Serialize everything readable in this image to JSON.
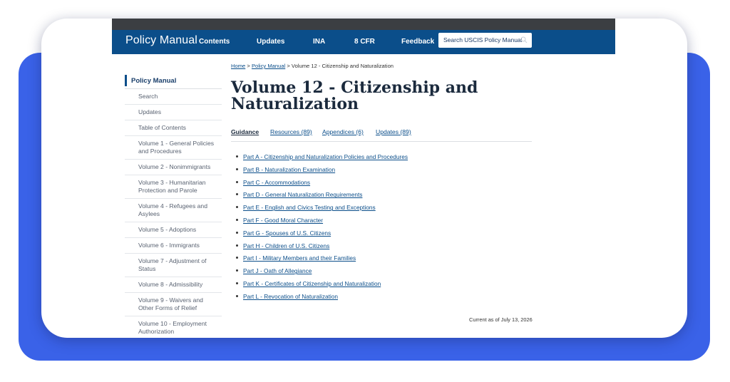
{
  "header": {
    "brand": "Policy Manual",
    "nav": [
      "Contents",
      "Updates",
      "INA",
      "8 CFR",
      "Feedback"
    ],
    "search_placeholder": "Search USCIS Policy Manual"
  },
  "breadcrumb": {
    "home": "Home",
    "sep": ">",
    "policy_manual": "Policy Manual",
    "current": "Volume 12 - Citizenship and Naturalization"
  },
  "page_title": "Volume 12 - Citizenship and Naturalization",
  "tabs": [
    "Guidance",
    "Resources (89)",
    "Appendices (6)",
    "Updates (89)"
  ],
  "parts": [
    "Part A - Citizenship and Naturalization Policies and Procedures",
    "Part B - Naturalization Examination",
    "Part C - Accommodations",
    "Part D - General Naturalization Requirements",
    "Part E - English and Civics Testing and Exceptions",
    "Part F - Good Moral Character",
    "Part G - Spouses of U.S. Citizens",
    "Part H - Children of U.S. Citizens",
    "Part I - Military Members and their Families",
    "Part J - Oath of Allegiance",
    "Part K - Certificates of Citizenship and Naturalization",
    "Part L - Revocation of Naturalization"
  ],
  "sidebar": {
    "heading": "Policy Manual",
    "items": [
      "Search",
      "Updates",
      "Table of Contents",
      "Volume 1 - General Policies and Procedures",
      "Volume 2 - Nonimmigrants",
      "Volume 3 - Humanitarian Protection and Parole",
      "Volume 4 - Refugees and Asylees",
      "Volume 5 - Adoptions",
      "Volume 6 - Immigrants",
      "Volume 7 - Adjustment of Status",
      "Volume 8 - Admissibility",
      "Volume 9 - Waivers and Other Forms of Relief",
      "Volume 10 - Employment Authorization"
    ]
  },
  "current_as_of": "Current as of July 13, 2026",
  "colors": {
    "nav_blue": "#0b4e8a",
    "backdrop_blue": "#3a62e8",
    "title": "#1b2a3d"
  }
}
